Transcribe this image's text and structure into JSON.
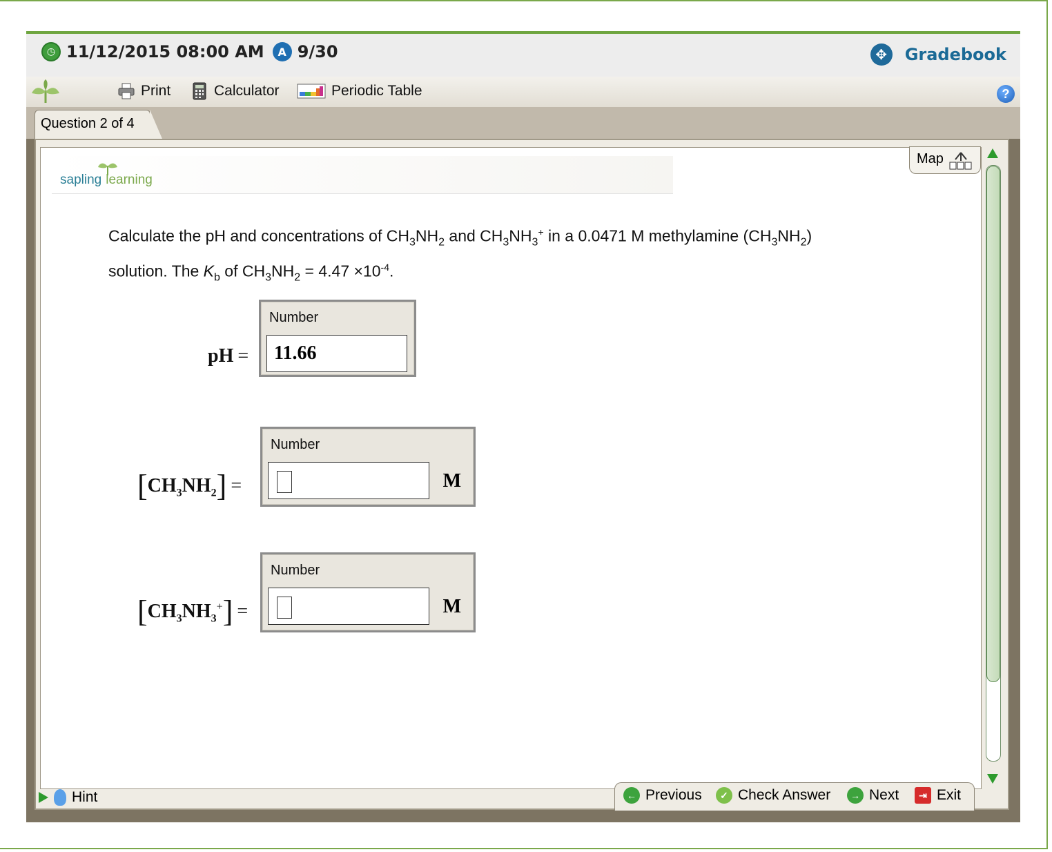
{
  "header": {
    "due_datetime": "11/12/2015 08:00 AM",
    "attempt_score": "9/30",
    "gradebook_label": "Gradebook"
  },
  "toolbar": {
    "print_label": "Print",
    "calculator_label": "Calculator",
    "periodic_table_label": "Periodic Table"
  },
  "tab": {
    "label": "Question 2 of 4"
  },
  "logo": {
    "sapling": "sapling",
    "learning": "learning"
  },
  "map_label": "Map",
  "question": {
    "line1_a": "Calculate the pH and concentrations of CH",
    "line1_b": "3",
    "line1_c": "NH",
    "line1_d": "2",
    "line1_e": " and CH",
    "line1_f": "3",
    "line1_g": "NH",
    "line1_h": "3",
    "line1_i": "+",
    "line1_j": " in a 0.0471 M methylamine (CH",
    "line1_k": "3",
    "line1_l": "NH",
    "line1_m": "2",
    "line1_n": ")",
    "line2_a": "solution. The ",
    "line2_k": "K",
    "line2_b": "b",
    "line2_c": " of CH",
    "line2_d": "3",
    "line2_e": "NH",
    "line2_f": "2",
    "line2_g": " = 4.47 ×10",
    "line2_h": "-4",
    "line2_i": "."
  },
  "answers": [
    {
      "label_main": "pH",
      "eq": "=",
      "caption": "Number",
      "value": "11.66",
      "unit": ""
    },
    {
      "label_main": "CH",
      "sub1": "3",
      "label_mid": "NH",
      "sub2": "2",
      "eq": "=",
      "caption": "Number",
      "value": "",
      "unit": "M"
    },
    {
      "label_main": "CH",
      "sub1": "3",
      "label_mid": "NH",
      "sub2": "3",
      "sup": "+",
      "eq": "=",
      "caption": "Number",
      "value": "",
      "unit": "M"
    }
  ],
  "nav": {
    "previous": "Previous",
    "check_answer": "Check Answer",
    "next": "Next",
    "exit": "Exit"
  },
  "hint_label": "Hint",
  "colors": {
    "accent_green": "#6ea53f",
    "brand_blue": "#1b6a96"
  }
}
